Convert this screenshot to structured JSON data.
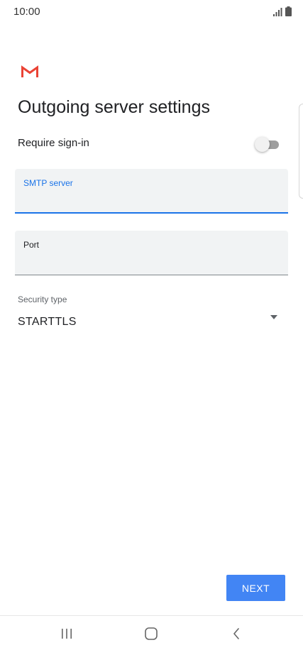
{
  "status_bar": {
    "time": "10:00",
    "icons": [
      "signal-icon",
      "battery-icon"
    ]
  },
  "app": {
    "logo": "gmail-logo",
    "brand_color": "#EA4335"
  },
  "page": {
    "title": "Outgoing server settings"
  },
  "require_signin": {
    "label": "Require sign-in",
    "enabled": false
  },
  "smtp_field": {
    "label": "SMTP server",
    "value": "",
    "focused": true
  },
  "port_field": {
    "label": "Port",
    "value": ""
  },
  "security": {
    "label": "Security type",
    "selected": "STARTTLS"
  },
  "actions": {
    "next_label": "NEXT"
  },
  "colors": {
    "accent": "#1a73e8",
    "button": "#4285f4",
    "field_bg": "#f1f3f4"
  },
  "nav_bar": {
    "buttons": [
      "recents-icon",
      "home-icon",
      "back-icon"
    ]
  }
}
